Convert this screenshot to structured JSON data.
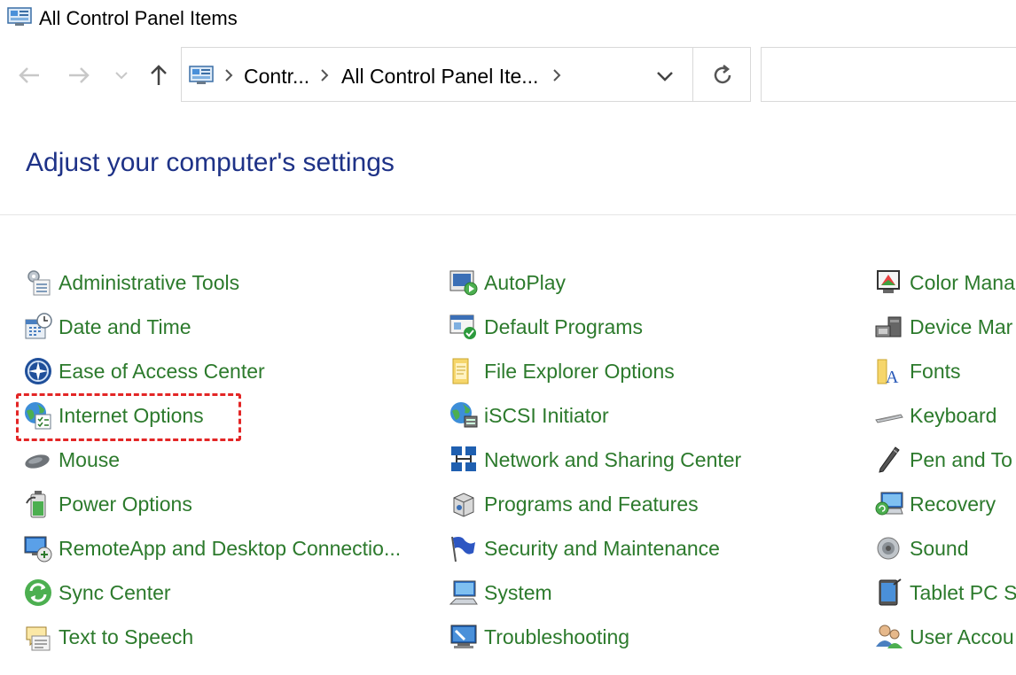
{
  "window": {
    "title": "All Control Panel Items",
    "icon": "control-panel-icon"
  },
  "navigation": {
    "back_icon": "arrow-left-icon",
    "forward_icon": "arrow-right-icon",
    "recent_icon": "chevron-down-icon",
    "up_icon": "arrow-up-icon",
    "breadcrumbs": [
      "Contr...",
      "All Control Panel Ite..."
    ],
    "refresh_icon": "refresh-icon",
    "search_placeholder": ""
  },
  "main": {
    "heading": "Adjust your computer's settings",
    "columns": [
      [
        {
          "label": "Administrative Tools",
          "icon": "admin-tools-icon"
        },
        {
          "label": "Date and Time",
          "icon": "calendar-clock-icon"
        },
        {
          "label": "Ease of Access Center",
          "icon": "ease-of-access-icon"
        },
        {
          "label": "Internet Options",
          "icon": "globe-check-icon"
        },
        {
          "label": "Mouse",
          "icon": "mouse-icon"
        },
        {
          "label": "Power Options",
          "icon": "battery-icon"
        },
        {
          "label": "RemoteApp and Desktop Connectio...",
          "icon": "remote-desktop-icon"
        },
        {
          "label": "Sync Center",
          "icon": "sync-icon"
        },
        {
          "label": "Text to Speech",
          "icon": "speech-bubble-icon"
        }
      ],
      [
        {
          "label": "AutoPlay",
          "icon": "autoplay-icon"
        },
        {
          "label": "Default Programs",
          "icon": "default-programs-icon"
        },
        {
          "label": "File Explorer Options",
          "icon": "folder-options-icon"
        },
        {
          "label": "iSCSI Initiator",
          "icon": "iscsi-globe-icon"
        },
        {
          "label": "Network and Sharing Center",
          "icon": "network-icon"
        },
        {
          "label": "Programs and Features",
          "icon": "programs-box-icon"
        },
        {
          "label": "Security and Maintenance",
          "icon": "flag-icon"
        },
        {
          "label": "System",
          "icon": "computer-icon"
        },
        {
          "label": "Troubleshooting",
          "icon": "troubleshoot-icon"
        }
      ],
      [
        {
          "label": "Color Mana",
          "icon": "color-management-icon"
        },
        {
          "label": "Device Mar",
          "icon": "device-manager-icon"
        },
        {
          "label": "Fonts",
          "icon": "fonts-folder-icon"
        },
        {
          "label": "Keyboard",
          "icon": "keyboard-icon"
        },
        {
          "label": "Pen and To",
          "icon": "pen-icon"
        },
        {
          "label": "Recovery",
          "icon": "recovery-icon"
        },
        {
          "label": "Sound",
          "icon": "speaker-icon"
        },
        {
          "label": "Tablet PC S",
          "icon": "tablet-icon"
        },
        {
          "label": "User Accou",
          "icon": "users-icon"
        }
      ]
    ]
  },
  "colors": {
    "heading": "#1e3287",
    "link": "#2c7a2c",
    "highlight": "#e32626"
  }
}
